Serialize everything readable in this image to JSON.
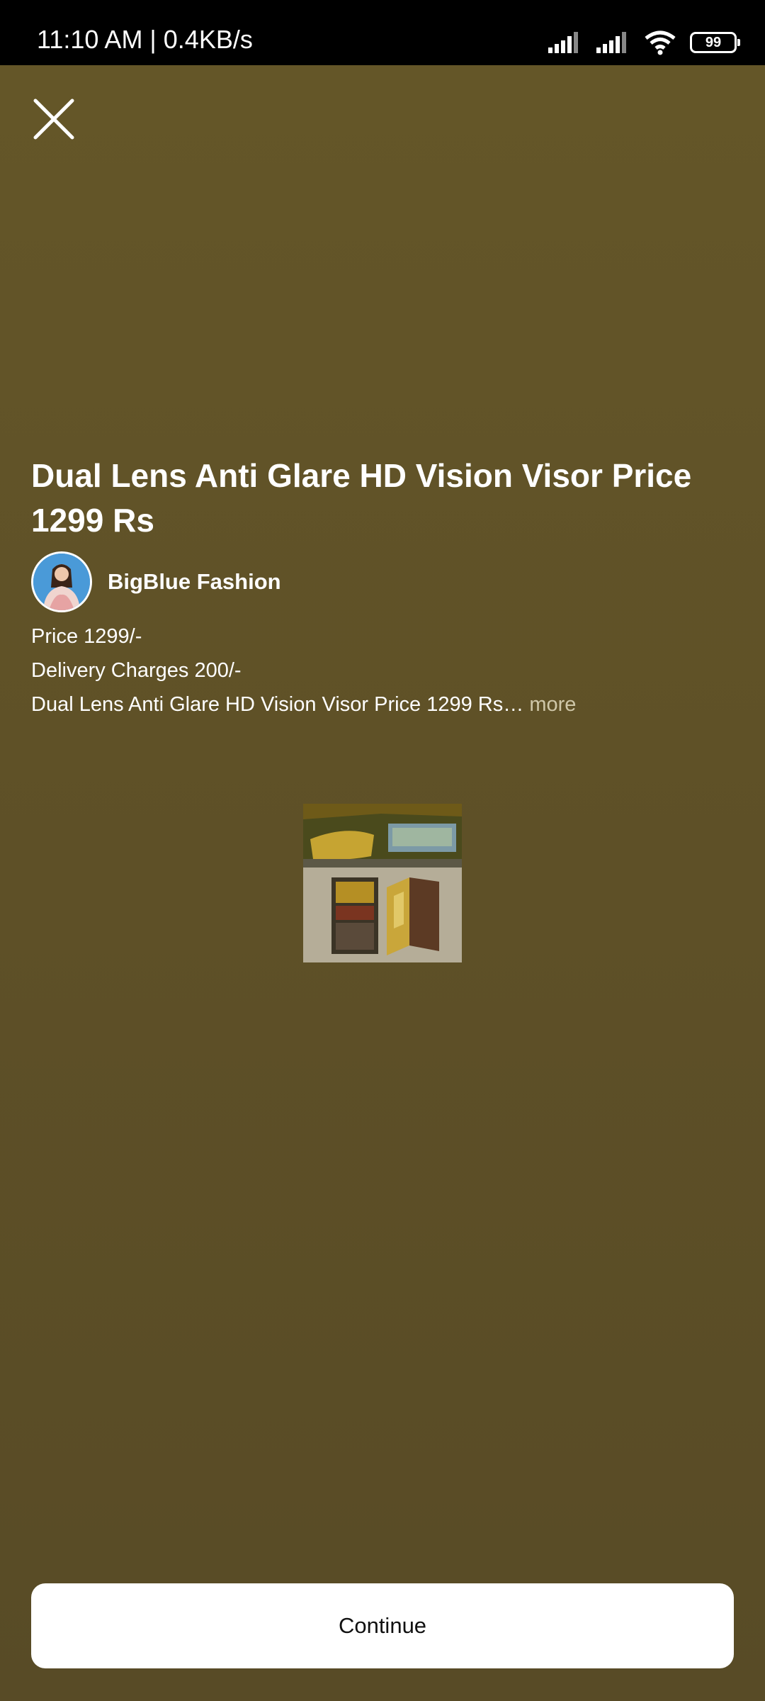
{
  "status_bar": {
    "time": "11:10 AM | 0.4KB/s",
    "battery": "99"
  },
  "post": {
    "title": "Dual Lens Anti Glare HD Vision Visor Price 1299 Rs",
    "author": "BigBlue Fashion",
    "description_lines": [
      "Price 1299/-",
      "Delivery Charges 200/-",
      "Dual Lens Anti Glare HD Vision Visor Price 1299 Rs…"
    ],
    "more_label": "more"
  },
  "actions": {
    "continue_label": "Continue"
  },
  "icons": {
    "close": "close-icon",
    "signal": "signal-icon",
    "wifi": "wifi-icon",
    "battery": "battery-icon"
  },
  "colors": {
    "background": "#5c4f27",
    "button": "#ffffff"
  }
}
